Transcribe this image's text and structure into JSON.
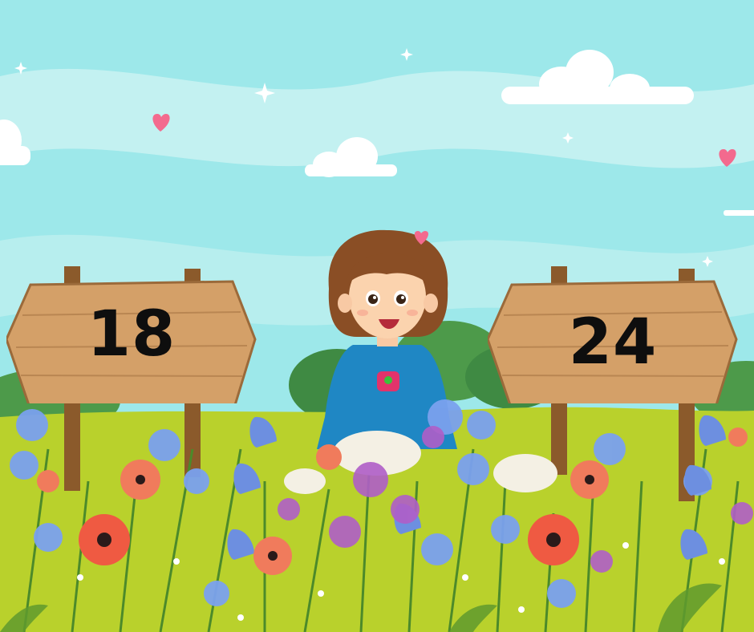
{
  "signs": {
    "left_number": "18",
    "right_number": "24"
  },
  "colors": {
    "sky": "#9de8ea",
    "sky_band": "#c3f1f1",
    "grass": "#b8cf2c",
    "sign_wood": "#d4a068",
    "sign_post": "#8b5a2b",
    "girl_dress": "#1f87c4",
    "girl_hair": "#8a4e25"
  },
  "icons": [
    "cloud-icon",
    "heart-icon",
    "sparkle-icon",
    "poppy-flower-icon",
    "bluebell-flower-icon",
    "cornflower-icon"
  ]
}
